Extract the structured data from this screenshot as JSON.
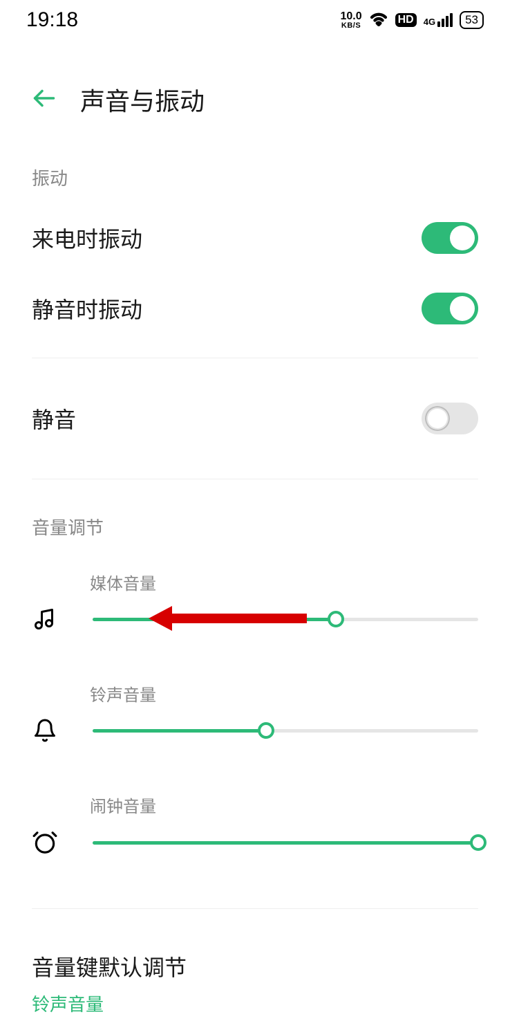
{
  "status": {
    "time": "19:18",
    "net_speed_top": "10.0",
    "net_speed_bot": "KB/S",
    "hd_label": "HD",
    "net_label": "4G",
    "battery": "53"
  },
  "header": {
    "title": "声音与振动"
  },
  "sections": {
    "vibration_label": "振动",
    "volume_label": "音量调节"
  },
  "toggles": {
    "vibrate_on_call": {
      "label": "来电时振动",
      "on": true
    },
    "vibrate_on_silent": {
      "label": "静音时振动",
      "on": true
    },
    "silent_mode": {
      "label": "静音",
      "on": false
    }
  },
  "sliders": {
    "media": {
      "label": "媒体音量",
      "percent": 63
    },
    "ring": {
      "label": "铃声音量",
      "percent": 45
    },
    "alarm": {
      "label": "闹钟音量",
      "percent": 100
    }
  },
  "volume_key": {
    "title": "音量键默认调节",
    "value": "铃声音量"
  },
  "colors": {
    "accent": "#2dba78"
  }
}
